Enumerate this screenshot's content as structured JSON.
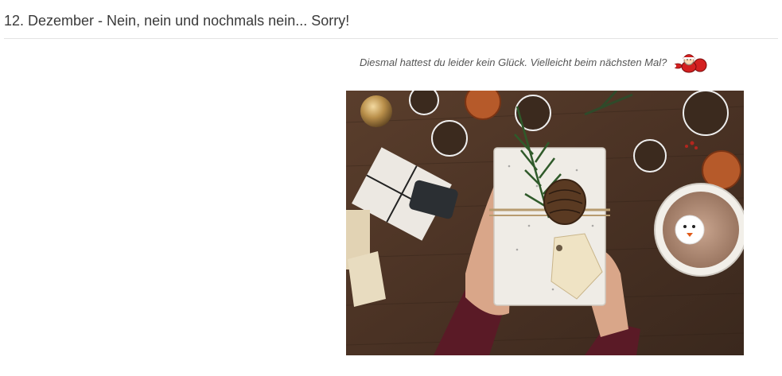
{
  "page": {
    "title": "12. Dezember - Nein, nein und nochmals nein... Sorry!"
  },
  "result": {
    "message": "Diesmal hattest du leider kein Glück. Vielleicht beim nächsten Mal?",
    "santa_icon": "santa-claus-icon"
  },
  "photo": {
    "subject": "christmas-gift-photo"
  },
  "colors": {
    "title": "#3a3a3a",
    "divider": "#e3e3e3",
    "wood": "#4a3426"
  }
}
